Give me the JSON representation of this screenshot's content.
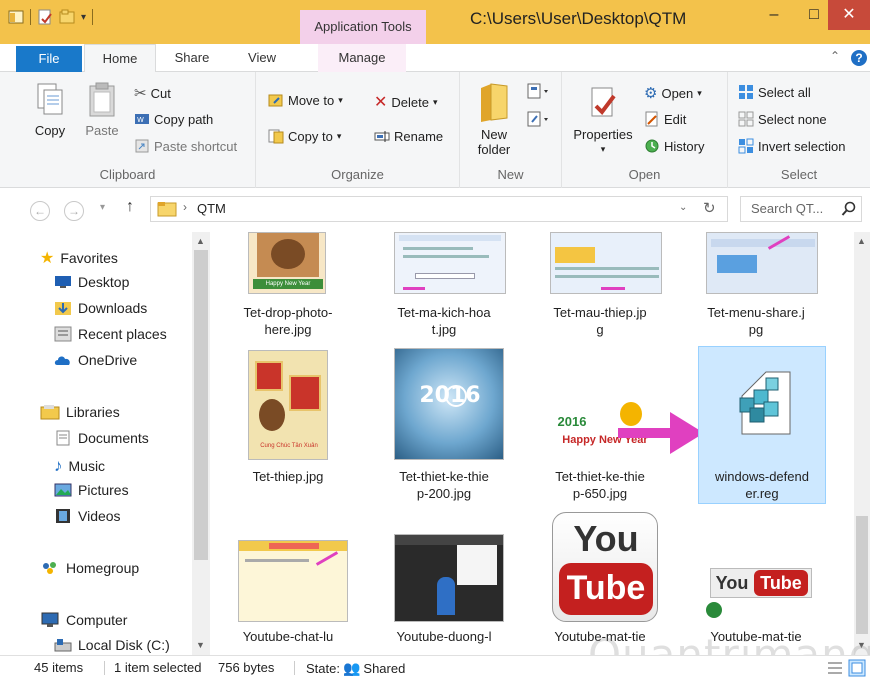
{
  "window": {
    "title": "C:\\Users\\User\\Desktop\\QTM",
    "context_tab": "Application Tools",
    "minimize": "–",
    "maximize": "□",
    "close": "✕"
  },
  "tabs": {
    "file": "File",
    "home": "Home",
    "share": "Share",
    "view": "View",
    "manage": "Manage"
  },
  "ribbon": {
    "clipboard": {
      "label": "Clipboard",
      "copy": "Copy",
      "paste": "Paste",
      "cut": "Cut",
      "copy_path": "Copy path",
      "paste_shortcut": "Paste shortcut"
    },
    "organize": {
      "label": "Organize",
      "move_to": "Move to",
      "copy_to": "Copy to",
      "delete": "Delete",
      "rename": "Rename"
    },
    "new": {
      "label": "New",
      "new_folder_1": "New",
      "new_folder_2": "folder"
    },
    "open": {
      "label": "Open",
      "properties": "Properties",
      "open": "Open",
      "edit": "Edit",
      "history": "History"
    },
    "select": {
      "label": "Select",
      "select_all": "Select all",
      "select_none": "Select none",
      "invert": "Invert selection"
    }
  },
  "address": {
    "path": "QTM",
    "search_placeholder": "Search QT..."
  },
  "nav": {
    "favorites": "Favorites",
    "desktop": "Desktop",
    "downloads": "Downloads",
    "recent": "Recent places",
    "onedrive": "OneDrive",
    "libraries": "Libraries",
    "documents": "Documents",
    "music": "Music",
    "pictures": "Pictures",
    "videos": "Videos",
    "homegroup": "Homegroup",
    "computer": "Computer",
    "local_disk": "Local Disk (C:)"
  },
  "files": [
    {
      "l1": "Tet-drop-photo-",
      "l2": "here.jpg"
    },
    {
      "l1": "Tet-ma-kich-hoa",
      "l2": "t.jpg"
    },
    {
      "l1": "Tet-mau-thiep.jp",
      "l2": "g"
    },
    {
      "l1": "Tet-menu-share.j",
      "l2": "pg"
    },
    {
      "l1": "Tet-thiep.jpg",
      "l2": ""
    },
    {
      "l1": "Tet-thiet-ke-thie",
      "l2": "p-200.jpg"
    },
    {
      "l1": "Tet-thiet-ke-thie",
      "l2": "p-650.jpg"
    },
    {
      "l1": "windows-defend",
      "l2": "er.reg"
    },
    {
      "l1": "Youtube-chat-lu",
      "l2": ""
    },
    {
      "l1": "Youtube-duong-l",
      "l2": ""
    },
    {
      "l1": "Youtube-mat-tie",
      "l2": ""
    },
    {
      "l1": "Youtube-mat-tie",
      "l2": ""
    }
  ],
  "thumb_text": {
    "happy_new_year": "Happy New Year",
    "year": "2016",
    "card_caption": "Cung Chúc Tân Xuân",
    "you": "You",
    "tube": "Tube"
  },
  "status": {
    "items": "45 items",
    "selected": "1 item selected",
    "size": "756 bytes",
    "state_label": "State:",
    "state_value": "Shared"
  },
  "watermark": "Quantrimang"
}
